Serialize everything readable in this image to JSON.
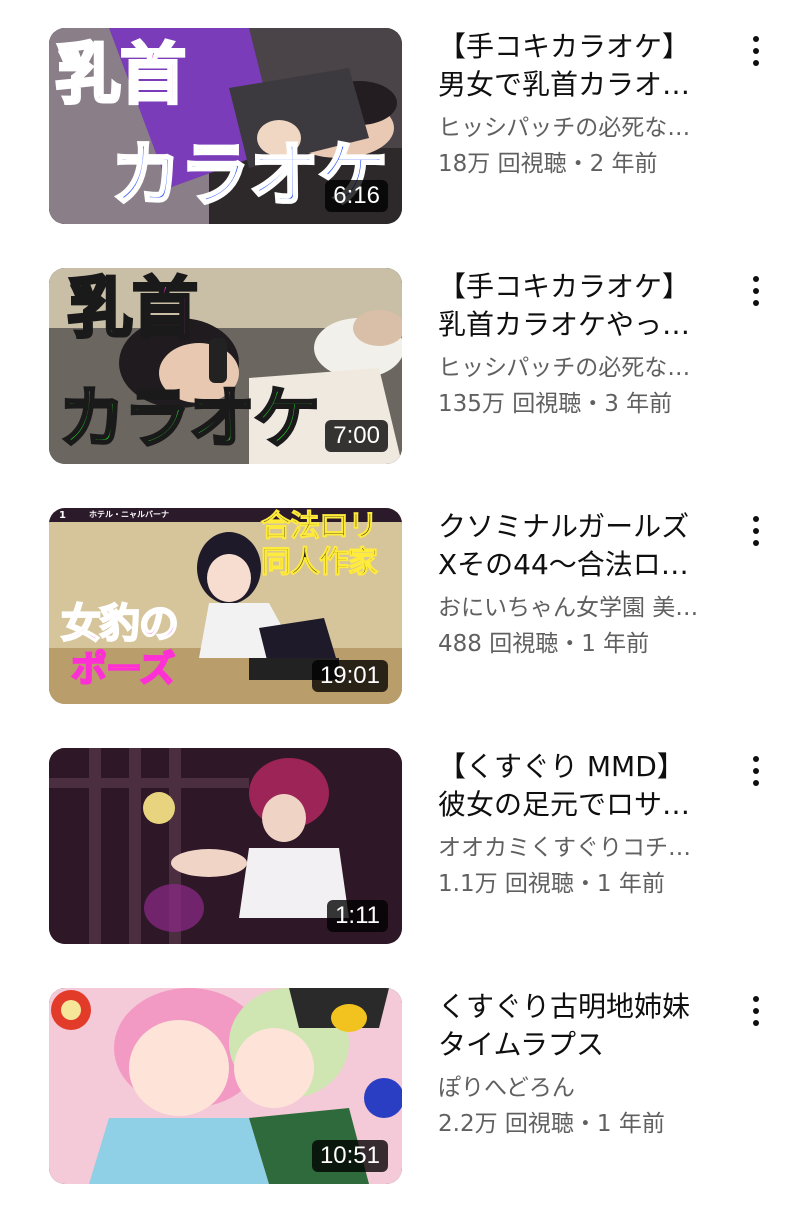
{
  "videos": [
    {
      "title_line1": "【手コキカラオケ】",
      "title_line2": "男女で乳首カラオ…",
      "channel": "ヒッシパッチの必死な…",
      "stats": "18万 回視聴・2 年前",
      "duration": "6:16",
      "thumb_text": [
        "乳首",
        "カラオケ"
      ],
      "colors": {
        "text1": "#ff2fd6",
        "text2": "#2350ff"
      }
    },
    {
      "title_line1": "【手コキカラオケ】",
      "title_line2": "乳首カラオケやっ…",
      "channel": "ヒッシパッチの必死な…",
      "stats": "135万 回視聴・3 年前",
      "duration": "7:00",
      "thumb_text": [
        "乳首",
        "カラオケ"
      ],
      "colors": {
        "text1": "#ff2fd6",
        "text2": "#22d62a"
      }
    },
    {
      "title_line1": "クソミナルガールズ",
      "title_line2": "Xその44～合法ロ…",
      "channel": "おにいちゃん女学園 美…",
      "stats": "488 回視聴・1 年前",
      "duration": "19:01",
      "thumb_text": [
        "合法ロリ",
        "同人作家",
        "女豹の",
        "ポーズ"
      ],
      "thumb_small": [
        "1",
        "ホテル・ニャルバーナ"
      ],
      "colors": {
        "text1": "#1a1a1a",
        "text2": "#ff2fd6"
      }
    },
    {
      "title_line1": "【くすぐり MMD】",
      "title_line2": "彼女の足元でロサ…",
      "channel": "オオカミくすぐりコチ…",
      "stats": "1.1万 回視聴・1 年前",
      "duration": "1:11",
      "colors": {
        "bg": "#3a1a2e"
      }
    },
    {
      "title_line1": "くすぐり古明地姉妹",
      "title_line2": "タイムラプス",
      "channel": "ぽりへどろん",
      "stats": "2.2万 回視聴・1 年前",
      "duration": "10:51",
      "colors": {
        "bg": "#f4c9d8"
      }
    }
  ],
  "icons": {
    "more": "more-vert-icon"
  }
}
